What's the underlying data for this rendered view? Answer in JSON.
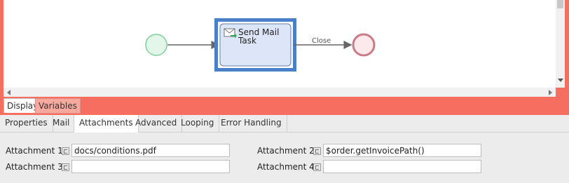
{
  "diagram": {
    "task_label_line1": "Send Mail",
    "task_label_line2": "Task",
    "flow_label": "Close",
    "colors": {
      "start_event_fill": "#e3f6ea",
      "start_event_stroke": "#7fcf9b",
      "end_event_fill": "#fbe9ec",
      "end_event_stroke": "#c97b86",
      "task_selection": "#4a7fc9",
      "task_fill": "#dde6f8",
      "flow": "#666666"
    }
  },
  "bottom_tabs": {
    "display_label": "Display",
    "variables_label": "Variables"
  },
  "property_tabs": [
    {
      "label": "Properties"
    },
    {
      "label": "Mail"
    },
    {
      "label": "Attachments"
    },
    {
      "label": "Advanced"
    },
    {
      "label": "Looping"
    },
    {
      "label": "Error Handling"
    }
  ],
  "active_tab": "Attachments",
  "form": {
    "attachment1_label": "Attachment 1",
    "attachment1_value": "docs/conditions.pdf",
    "attachment2_label": "Attachment 2",
    "attachment2_value": "$order.getInvoicePath()",
    "attachment3_label": "Attachment 3",
    "attachment3_value": "",
    "attachment4_label": "Attachment 4",
    "attachment4_value": ""
  },
  "colors": {
    "accent_frame": "#f56e60"
  }
}
